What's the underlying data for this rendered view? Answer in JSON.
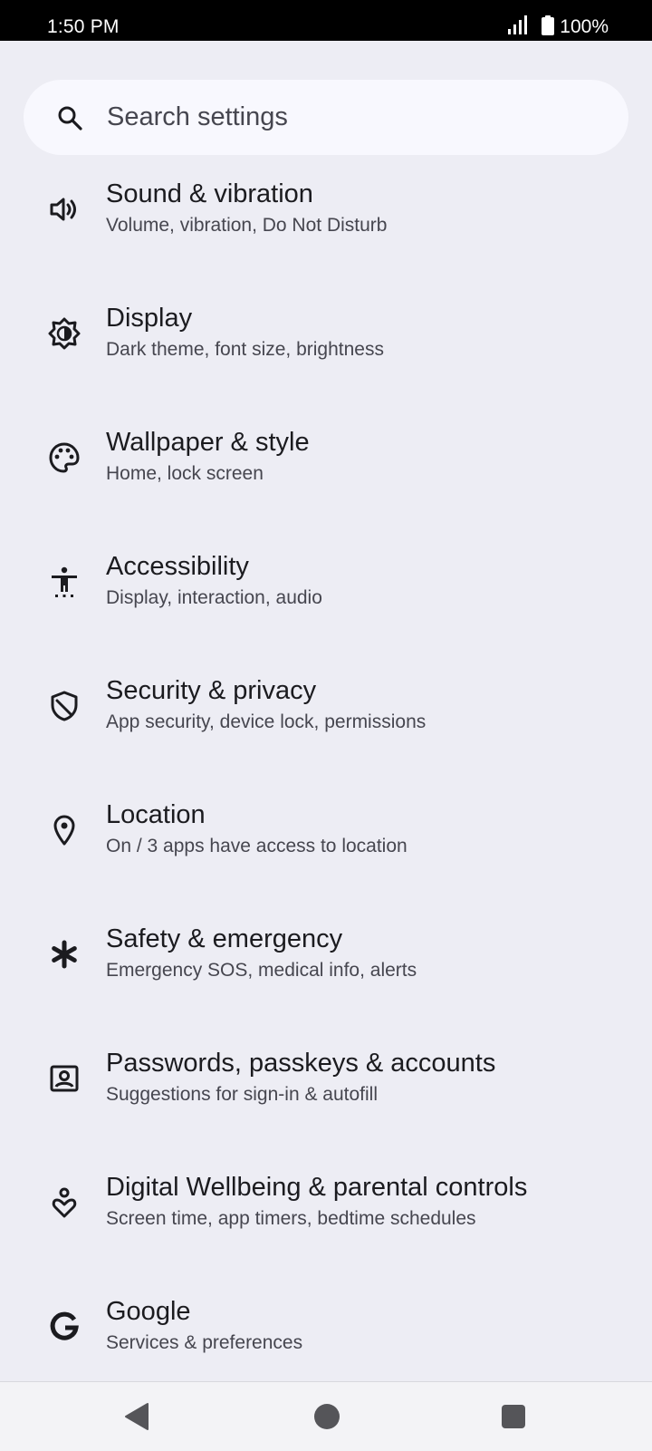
{
  "status_bar": {
    "time": "1:50 PM",
    "battery": "100%",
    "icons": [
      "signal-icon",
      "battery-icon"
    ]
  },
  "search": {
    "placeholder": "Search settings",
    "icon": "search-icon"
  },
  "settings": [
    {
      "title": "Sound & vibration",
      "subtitle": "Volume, vibration, Do Not Disturb",
      "icon": "volume-icon"
    },
    {
      "title": "Display",
      "subtitle": "Dark theme, font size, brightness",
      "icon": "brightness-icon"
    },
    {
      "title": "Wallpaper & style",
      "subtitle": "Home, lock screen",
      "icon": "palette-icon"
    },
    {
      "title": "Accessibility",
      "subtitle": "Display, interaction, audio",
      "icon": "accessibility-icon"
    },
    {
      "title": "Security & privacy",
      "subtitle": "App security, device lock, permissions",
      "icon": "shield-icon"
    },
    {
      "title": "Location",
      "subtitle": "On / 3 apps have access to location",
      "icon": "location-pin-icon"
    },
    {
      "title": "Safety & emergency",
      "subtitle": "Emergency SOS, medical info, alerts",
      "icon": "asterisk-icon"
    },
    {
      "title": "Passwords, passkeys & accounts",
      "subtitle": "Suggestions for sign-in & autofill",
      "icon": "account-box-icon"
    },
    {
      "title": "Digital Wellbeing & parental controls",
      "subtitle": "Screen time, app timers, bedtime schedules",
      "icon": "wellbeing-icon"
    },
    {
      "title": "Google",
      "subtitle": "Services & preferences",
      "icon": "google-icon"
    }
  ],
  "nav_bar": {
    "icons": [
      "back-icon",
      "home-icon",
      "recents-icon"
    ]
  },
  "colors": {
    "background": "#ededf4",
    "search_background": "#f8f8fe",
    "title_text": "#1b1b1f",
    "subtitle_text": "#46464f"
  }
}
